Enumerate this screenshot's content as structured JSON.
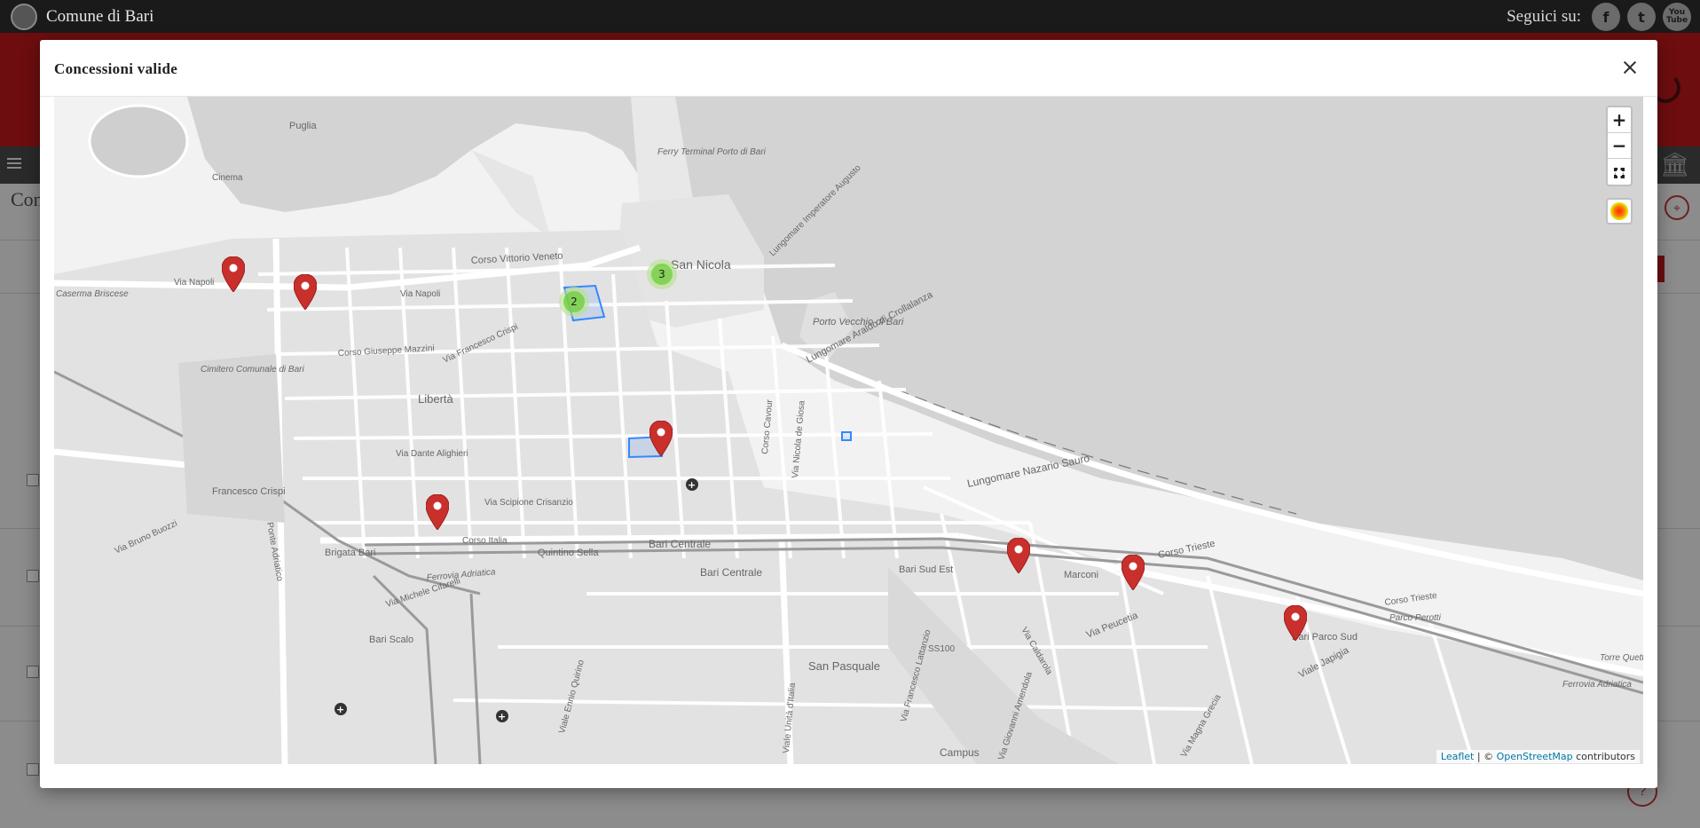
{
  "header": {
    "site_name": "Comune di Bari",
    "social_label": "Seguici su:",
    "social": [
      {
        "name": "facebook",
        "glyph": "f"
      },
      {
        "name": "twitter",
        "glyph": "t"
      },
      {
        "name": "youtube",
        "glyph": "You\nTube"
      }
    ]
  },
  "background": {
    "title_fragment": "Con"
  },
  "modal": {
    "title": "Concessioni valide",
    "close_label": "×"
  },
  "map": {
    "zoom_in": "+",
    "zoom_out": "−",
    "clusters": [
      {
        "count": "2"
      },
      {
        "count": "3"
      }
    ],
    "street_labels": {
      "san_nicola": "San Nicola",
      "corso_vittorio_veneto": "Corso Vittorio Veneto",
      "via_napoli": "Via Napoli",
      "corso_italia": "Corso Italia",
      "bari_centrale": "Bari Centrale",
      "bari_centrale_fs": "Bari Centrale (FS)",
      "lungomare_nazario_sauro": "Lungomare Nazario Sauro",
      "lungomare_araldo": "Lungomare Araldo di Crollalanza",
      "porto_vecchio": "Porto Vecchio di Bari",
      "liberta": "Libertà",
      "san_pasquale": "San Pasquale",
      "marconi": "Marconi",
      "corso_trieste": "Corso Trieste",
      "bari_scalo": "Bari Scalo",
      "francesco_crispi": "Francesco Crispi",
      "quintino_sella": "Quintino Sella",
      "brigata_bari": "Brigata Bari",
      "cimitero": "Cimitero Comunale di Bari",
      "cinema": "Cinema",
      "puglia": "Puglia",
      "via_peucetia": "Via Peucetia",
      "viale_japigia": "Viale Japigia",
      "bari_parco_sud": "Bari Parco Sud",
      "ferrovia_adriatica": "Ferrovia Adriatica",
      "campus": "Campus",
      "bari_sud_est": "Bari Sud Est",
      "via_dante_alighieri": "Via Dante Alighieri",
      "via_scipione_crisanzio": "Via Scipione Crisanzio",
      "corso_cavour": "Corso Cavour",
      "via_nicola_de_giosa": "Via Nicola de Giosa",
      "lungomare_imperatore_augusto": "Lungomare Imperatore Augusto",
      "ss100": "SS100",
      "ferry_terminal": "Ferry Terminal Porto di Bari",
      "via_giuseppe_mazzini": "Corso Giuseppe Mazzini",
      "via_francesco_crispi": "Via Francesco Crispi",
      "viale_unita_italia": "Viale Unità d'Italia",
      "via_francesco_lattanzio": "Via Francesco Lattanzio",
      "viale_ennio_quirino": "Viale Ennio Quirino",
      "via_bruno_buozzi": "Via Bruno Buozzi",
      "ponte_adriatico": "Ponte Adriatico",
      "via_michele_cifarelli": "Via Michele Cifarelli",
      "caserma_briscese": "Caserma Briscese",
      "corso_trieste_2": "Corso Trieste",
      "parco_perotti": "Parco Perotti",
      "via_caldarola": "Via Caldarola",
      "via_magna_grecia": "Via Magna Grecia",
      "torre_quetta": "Torre Quetta",
      "via_giovanni_amendola": "Via Giovanni Amendola"
    },
    "attribution": {
      "leaflet": "Leaflet",
      "separator": " | © ",
      "osm": "OpenStreetMap",
      "suffix": " contributors"
    }
  },
  "colors": {
    "marker": "#c9302c",
    "cluster_outer": "#b5e28c",
    "cluster_inner": "#6ecc39",
    "polygon": "#3388ff",
    "sea": "#d2d2d2",
    "land": "#f2f2f2"
  }
}
